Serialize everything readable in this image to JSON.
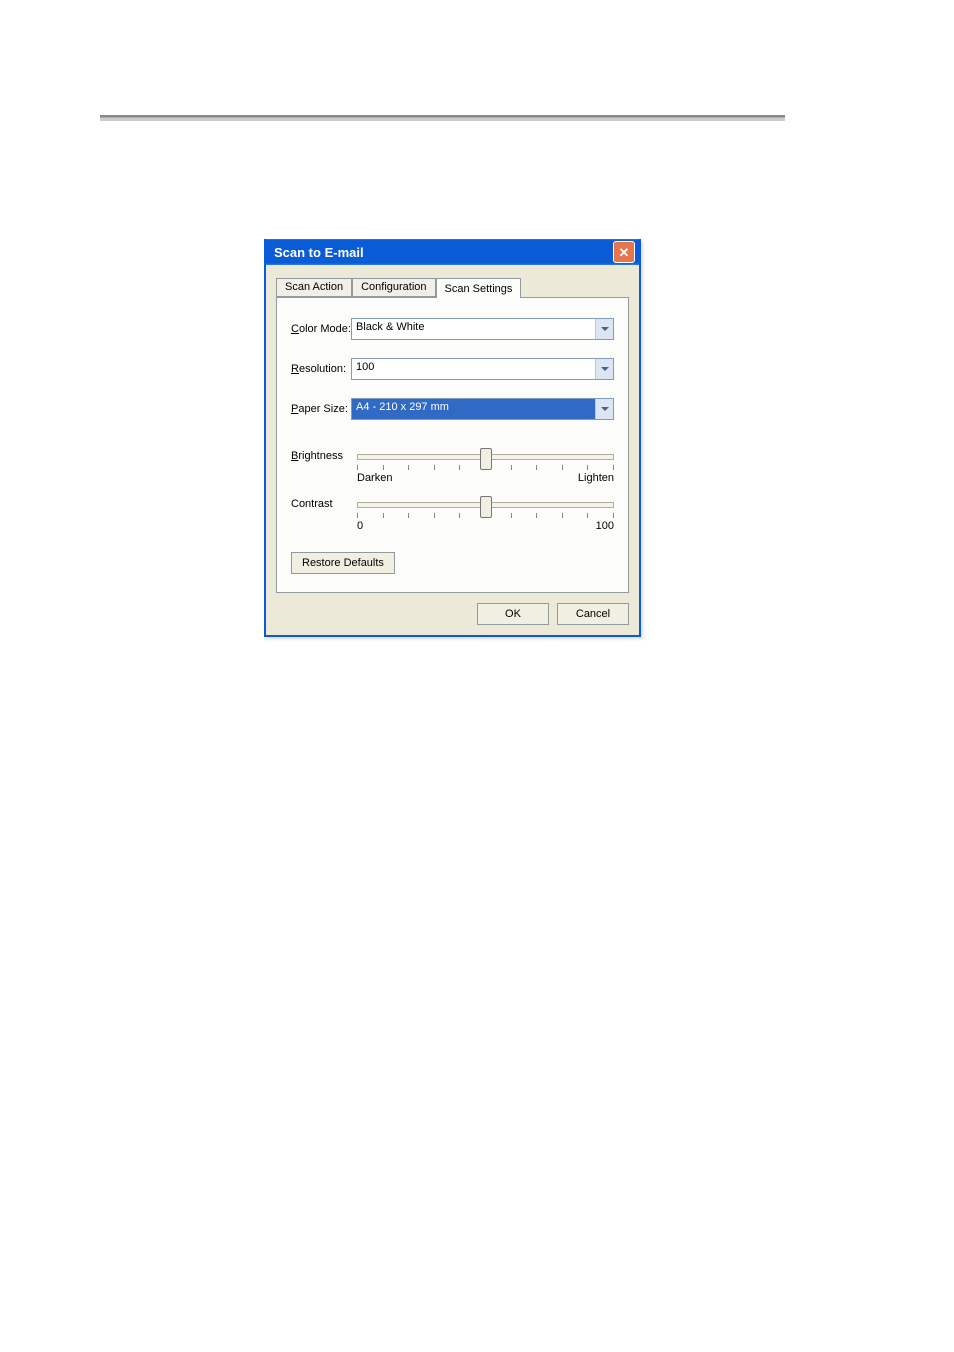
{
  "dialog": {
    "title": "Scan to E-mail",
    "tabs": {
      "scanAction": "Scan Action",
      "configuration": "Configuration",
      "scanSettings": "Scan Settings"
    },
    "fields": {
      "colorMode": {
        "label": "Color Mode:",
        "value": "Black & White"
      },
      "resolution": {
        "label": "Resolution:",
        "value": "100"
      },
      "paperSize": {
        "label": "Paper Size:",
        "value": "A4 - 210 x 297 mm"
      },
      "brightness": {
        "label": "Brightness",
        "leftLabel": "Darken",
        "rightLabel": "Lighten",
        "position": 50
      },
      "contrast": {
        "label": "Contrast",
        "leftLabel": "0",
        "rightLabel": "100",
        "position": 50
      }
    },
    "buttons": {
      "restore": "Restore Defaults",
      "ok": "OK",
      "cancel": "Cancel"
    }
  }
}
